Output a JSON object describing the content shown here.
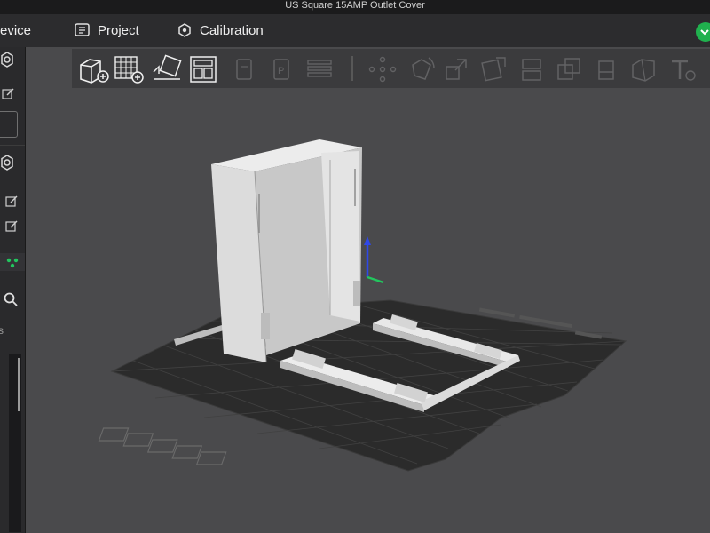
{
  "window": {
    "title": "US Square 15AMP Outlet Cover"
  },
  "menu": {
    "device_label": "evice",
    "project_label": "Project",
    "calibration_label": "Calibration"
  },
  "sidebar": {
    "section_label": "s"
  },
  "colors": {
    "status_dot": "#20b14e",
    "model": "#d9d9d9",
    "plate": "#2b2b2b"
  },
  "toolbar": {
    "icons": [
      "add-object-icon",
      "add-plate-icon",
      "auto-orient-icon",
      "arrange-icon",
      "copy-icon",
      "paste-icon",
      "layers-icon",
      "move-icon",
      "rotate-icon",
      "scale-icon",
      "split-icon",
      "cut-icon",
      "support-icon",
      "seam-icon",
      "measure-icon",
      "text-icon"
    ]
  },
  "viewport": {
    "plate_controls": [
      "view-icon",
      "slice-icon",
      "layout-icon",
      "settings-icon",
      "close-plate-icon"
    ]
  }
}
